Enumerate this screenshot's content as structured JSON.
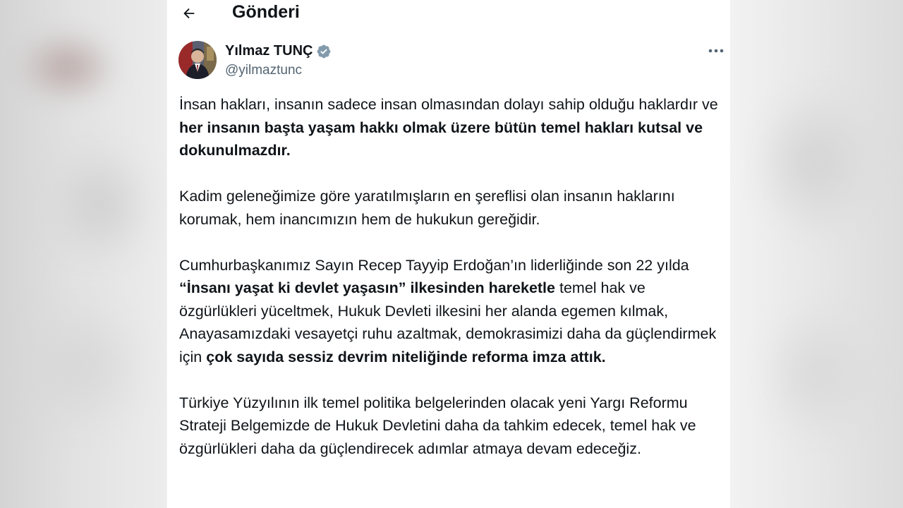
{
  "header": {
    "title": "Gönderi",
    "back_icon": "arrow-left-icon"
  },
  "author": {
    "name": "Yılmaz TUNÇ",
    "handle": "@yilmaztunc",
    "verified_icon": "verified-badge-icon",
    "verified_color": "#829aab",
    "more_icon": "more-horizontal-icon"
  },
  "tweet": {
    "p1": {
      "a": "İnsan hakları, insanın sadece insan olmasından dolayı sahip olduğu haklardır ve ",
      "b": "her insanın başta yaşam hakkı olmak üzere bütün temel hakları kutsal ve dokunulmazdır."
    },
    "p2": "Kadim geleneğimize göre yaratılmışların en şereflisi olan insanın haklarını korumak, hem inancımızın hem de hukukun gereğidir.",
    "p3": {
      "a": "Cumhurbaşkanımız Sayın Recep Tayyip Erdoğan’ın liderliğinde son 22 yılda ",
      "b": "“İnsanı yaşat ki devlet yaşasın” ilkesinden hareketle",
      "c": " temel hak ve özgürlükleri yüceltmek, Hukuk Devleti ilkesini her alanda egemen kılmak, Anayasamızdaki vesayetçi ruhu azaltmak, demokrasimizi daha da güçlendirmek için ",
      "d": "çok sayıda sessiz devrim niteliğinde reforma imza attık."
    },
    "p4": "Türkiye Yüzyılının ilk temel politika belgelerinden olacak yeni Yargı Reformu Strateji Belgemizde de Hukuk Devletini daha da tahkim edecek, temel hak ve özgürlükleri daha da güçlendirecek adımlar atmaya devam edeceğiz."
  },
  "colors": {
    "text": "#0f1419",
    "secondary": "#536471",
    "background": "#ffffff"
  }
}
